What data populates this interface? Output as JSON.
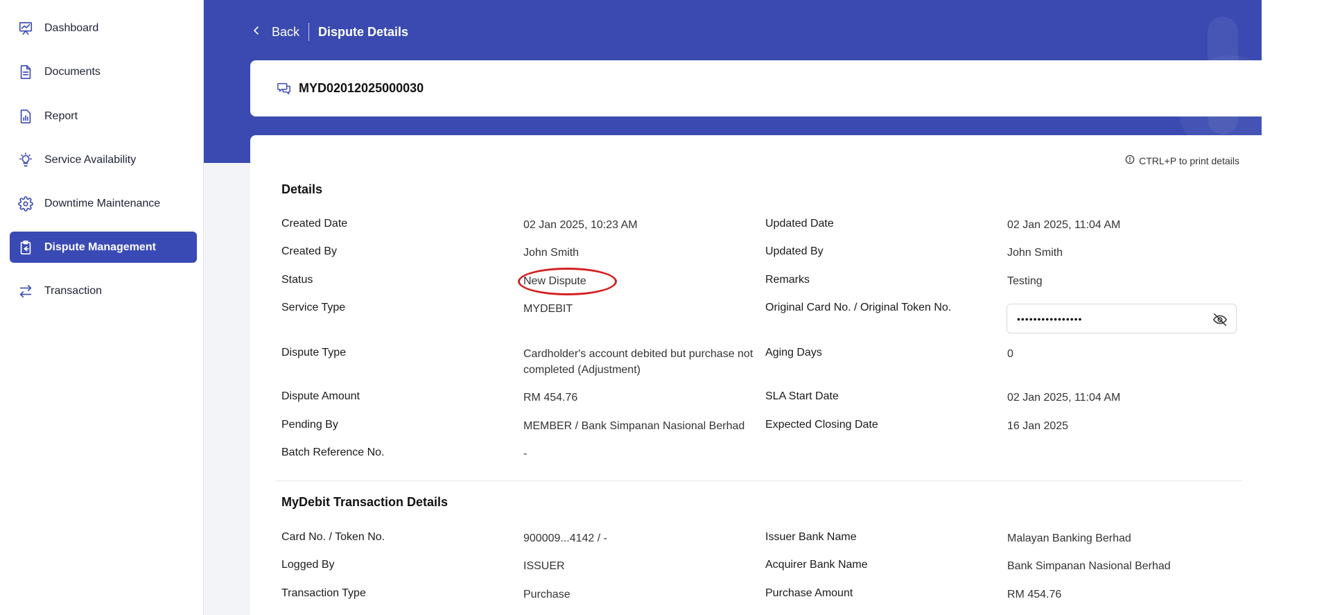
{
  "sidebar": {
    "items": [
      {
        "label": "Dashboard",
        "icon": "presentation-chart-icon",
        "active": false
      },
      {
        "label": "Documents",
        "icon": "document-icon",
        "active": false
      },
      {
        "label": "Report",
        "icon": "report-chart-icon",
        "active": false
      },
      {
        "label": "Service Availability",
        "icon": "lightbulb-icon",
        "active": false
      },
      {
        "label": "Downtime Maintenance",
        "icon": "gear-icon",
        "active": false
      },
      {
        "label": "Dispute Management",
        "icon": "clipboard-icon",
        "active": true
      },
      {
        "label": "Transaction",
        "icon": "arrows-exchange-icon",
        "active": false
      }
    ]
  },
  "header": {
    "back_label": "Back",
    "title": "Dispute Details"
  },
  "dispute": {
    "id": "MYD02012025000030"
  },
  "print_hint": "CTRL+P to print details",
  "details": {
    "title": "Details",
    "created_date_label": "Created Date",
    "created_date": "02 Jan 2025, 10:23 AM",
    "updated_date_label": "Updated Date",
    "updated_date": "02 Jan 2025, 11:04 AM",
    "created_by_label": "Created By",
    "created_by": "John Smith",
    "updated_by_label": "Updated By",
    "updated_by": "John Smith",
    "status_label": "Status",
    "status": "New Dispute",
    "remarks_label": "Remarks",
    "remarks": "Testing",
    "service_type_label": "Service Type",
    "service_type": "MYDEBIT",
    "card_label": "Original Card No. / Original Token No.",
    "card_masked": "••••••••••••••••",
    "dispute_type_label": "Dispute Type",
    "dispute_type": "Cardholder's account debited but purchase not completed (Adjustment)",
    "aging_days_label": "Aging Days",
    "aging_days": "0",
    "dispute_amount_label": "Dispute Amount",
    "dispute_amount": "RM 454.76",
    "sla_start_label": "SLA Start Date",
    "sla_start": "02 Jan 2025, 11:04 AM",
    "pending_by_label": "Pending By",
    "pending_by": "MEMBER / Bank Simpanan Nasional Berhad",
    "expected_closing_label": "Expected Closing Date",
    "expected_closing": "16 Jan 2025",
    "batch_ref_label": "Batch Reference No.",
    "batch_ref": "-"
  },
  "transaction": {
    "title": "MyDebit Transaction Details",
    "card_token_label": "Card No. / Token No.",
    "card_token": "900009...4142 / -",
    "issuer_bank_label": "Issuer Bank Name",
    "issuer_bank": "Malayan Banking Berhad",
    "logged_by_label": "Logged By",
    "logged_by": "ISSUER",
    "acquirer_bank_label": "Acquirer Bank Name",
    "acquirer_bank": "Bank Simpanan Nasional Berhad",
    "txn_type_label": "Transaction Type",
    "txn_type": "Purchase",
    "purchase_amount_label": "Purchase Amount",
    "purchase_amount": "RM 454.76"
  },
  "colors": {
    "primary": "#3a4ab4",
    "highlight_ring": "#d4201f"
  }
}
